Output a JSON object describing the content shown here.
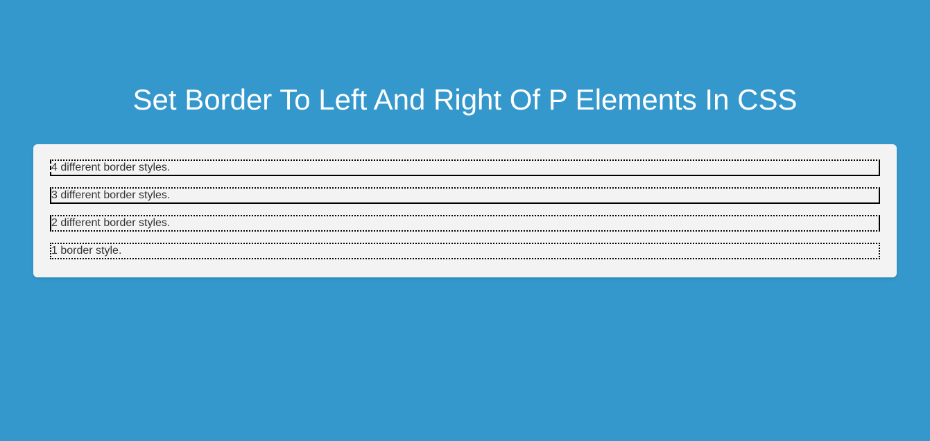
{
  "title": "Set Border To Left And Right Of P Elements In CSS",
  "examples": {
    "four": "4 different border styles.",
    "three": "3 different border styles.",
    "two": "2 different border styles.",
    "one": "1 border style."
  }
}
